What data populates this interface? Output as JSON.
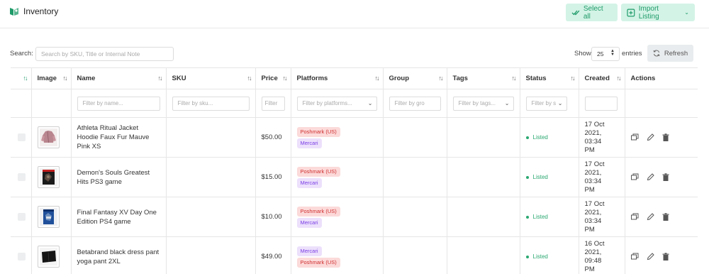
{
  "header": {
    "title": "Inventory",
    "select_all": "Select all",
    "import_listing": "Import Listing"
  },
  "toolbar": {
    "search_label": "Search:",
    "search_placeholder": "Search by SKU, Title or Internal Note",
    "show_label": "Show",
    "entries_value": "25",
    "entries_label": "entries",
    "refresh": "Refresh"
  },
  "table": {
    "columns": [
      "Image",
      "Name",
      "SKU",
      "Price",
      "Platforms",
      "Group",
      "Tags",
      "Status",
      "Created",
      "Actions"
    ],
    "filters": {
      "name": "Filter by name...",
      "sku": "Filter by sku...",
      "price": "Filter",
      "platforms": "Filter by platforms...",
      "group": "Filter by gro",
      "tags": "Filter by tags...",
      "status": "Filter by s"
    },
    "rows": [
      {
        "name": "Athleta Ritual Jacket Hoodie Faux Fur Mauve Pink XS",
        "sku": "",
        "price": "$50.00",
        "platforms": [
          "Poshmark (US)",
          "Mercari"
        ],
        "status": "Listed",
        "created_date": "17 Oct",
        "created_time": "2021, 03:34",
        "created_ampm": "PM",
        "thumb": "mauve-jacket"
      },
      {
        "name": "Demon's Souls Greatest Hits PS3 game",
        "sku": "",
        "price": "$15.00",
        "platforms": [
          "Poshmark (US)",
          "Mercari"
        ],
        "status": "Listed",
        "created_date": "17 Oct",
        "created_time": "2021, 03:34",
        "created_ampm": "PM",
        "thumb": "ps3-case"
      },
      {
        "name": "Final Fantasy XV Day One Edition PS4 game",
        "sku": "",
        "price": "$10.00",
        "platforms": [
          "Poshmark (US)",
          "Mercari"
        ],
        "status": "Listed",
        "created_date": "17 Oct",
        "created_time": "2021, 03:34",
        "created_ampm": "PM",
        "thumb": "ps4-case"
      },
      {
        "name": "Betabrand black dress pant yoga pant 2XL",
        "sku": "",
        "price": "$49.00",
        "platforms": [
          "Mercari",
          "Poshmark (US)"
        ],
        "status": "Listed",
        "created_date": "16 Oct",
        "created_time": "2021, 09:48",
        "created_ampm": "PM",
        "thumb": "black-pants"
      }
    ]
  },
  "colors": {
    "accent": "#1f9b6a",
    "accent_bg": "#d3f3e6",
    "poshmark": "#d03030",
    "mercari": "#7b3fe4",
    "listed": "#2aa871"
  }
}
